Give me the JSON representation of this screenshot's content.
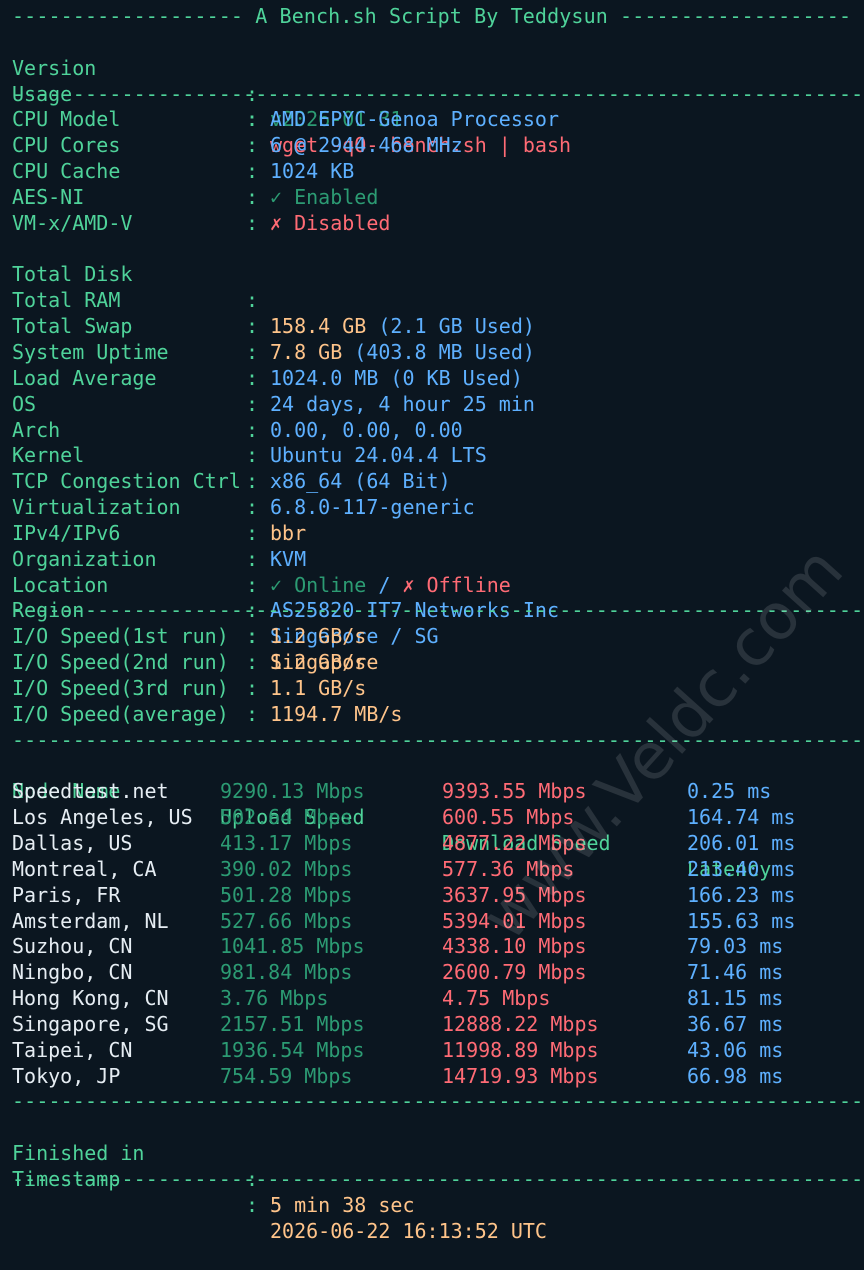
{
  "header": {
    "title_line": "------------------- A Bench.sh Script By Teddysun -------------------"
  },
  "meta": {
    "version_label": "Version",
    "version_value": "v2026-01-31",
    "usage_label": "Usage",
    "usage_value": "wget -qO- bench.sh | bash"
  },
  "separator": "----------------------------------------------------------------------",
  "system": {
    "rows": [
      {
        "label": "CPU Model",
        "value": "AMD EPYC-Genoa Processor",
        "color": "blue"
      },
      {
        "label": "CPU Cores",
        "value": "6 @ 2944.468 MHz",
        "color": "blue"
      },
      {
        "label": "CPU Cache",
        "value": "1024 KB",
        "color": "blue"
      },
      {
        "label": "AES-NI",
        "value": "✓ Enabled",
        "color": "green"
      },
      {
        "label": "VM-x/AMD-V",
        "value": "✗ Disabled",
        "color": "red"
      }
    ],
    "disk_label": "Total Disk",
    "disk_total": "158.4 GB",
    "disk_used": "(2.1 GB Used)",
    "ram_label": "Total RAM",
    "ram_total": "7.8 GB",
    "ram_used": "(403.8 MB Used)",
    "swap_label": "Total Swap",
    "swap_value": "1024.0 MB (0 KB Used)",
    "uptime_label": "System Uptime",
    "uptime_value": "24 days, 4 hour 25 min",
    "load_label": "Load Average",
    "load_value": "0.00, 0.00, 0.00",
    "os_label": "OS",
    "os_value": "Ubuntu 24.04.4 LTS",
    "arch_label": "Arch",
    "arch_value": "x86_64 (64 Bit)",
    "kernel_label": "Kernel",
    "kernel_value": "6.8.0-117-generic",
    "tcp_label": "TCP Congestion Ctrl",
    "tcp_value": "bbr",
    "virt_label": "Virtualization",
    "virt_value": "KVM",
    "ip_label": "IPv4/IPv6",
    "ipv4_value": "✓ Online",
    "ip_slash": "/",
    "ipv6_value": "✗ Offline",
    "org_label": "Organization",
    "org_value": "AS25820 IT7 Networks Inc",
    "location_label": "Location",
    "location_value": "Singapore / SG",
    "region_label": "Region",
    "region_value": "Singapore"
  },
  "io": {
    "rows": [
      {
        "label": "I/O Speed(1st run)",
        "value": "1.2 GB/s"
      },
      {
        "label": "I/O Speed(2nd run)",
        "value": "1.2 GB/s"
      },
      {
        "label": "I/O Speed(3rd run)",
        "value": "1.1 GB/s"
      },
      {
        "label": "I/O Speed(average)",
        "value": "1194.7 MB/s"
      }
    ]
  },
  "speedtest": {
    "headers": [
      "Node Name",
      "Upload Speed",
      "Download Speed",
      "Latency"
    ],
    "rows": [
      {
        "node": "Speedtest.net",
        "upload": "9290.13 Mbps",
        "download": "9393.55 Mbps",
        "latency": "0.25 ms"
      },
      {
        "node": "Los Angeles, US",
        "upload": "502.64 Mbps",
        "download": "600.55 Mbps",
        "latency": "164.74 ms"
      },
      {
        "node": "Dallas, US",
        "upload": "413.17 Mbps",
        "download": "4877.22 Mbps",
        "latency": "206.01 ms"
      },
      {
        "node": "Montreal, CA",
        "upload": "390.02 Mbps",
        "download": "577.36 Mbps",
        "latency": "213.40 ms"
      },
      {
        "node": "Paris, FR",
        "upload": "501.28 Mbps",
        "download": "3637.95 Mbps",
        "latency": "166.23 ms"
      },
      {
        "node": "Amsterdam, NL",
        "upload": "527.66 Mbps",
        "download": "5394.01 Mbps",
        "latency": "155.63 ms"
      },
      {
        "node": "Suzhou, CN",
        "upload": "1041.85 Mbps",
        "download": "4338.10 Mbps",
        "latency": "79.03 ms"
      },
      {
        "node": "Ningbo, CN",
        "upload": "981.84 Mbps",
        "download": "2600.79 Mbps",
        "latency": "71.46 ms"
      },
      {
        "node": "Hong Kong, CN",
        "upload": "3.76 Mbps",
        "download": "4.75 Mbps",
        "latency": "81.15 ms"
      },
      {
        "node": "Singapore, SG",
        "upload": "2157.51 Mbps",
        "download": "12888.22 Mbps",
        "latency": "36.67 ms"
      },
      {
        "node": "Taipei, CN",
        "upload": "1936.54 Mbps",
        "download": "11998.89 Mbps",
        "latency": "43.06 ms"
      },
      {
        "node": "Tokyo, JP",
        "upload": "754.59 Mbps",
        "download": "14719.93 Mbps",
        "latency": "66.98 ms"
      }
    ]
  },
  "footer": {
    "finished_label": "Finished in",
    "finished_value": "5 min 38 sec",
    "timestamp_label": "Timestamp",
    "timestamp_value": "2026-06-22 16:13:52 UTC"
  },
  "watermark": "www.Veldc.com",
  "colors": {
    "background": "#0b1620",
    "label_green": "#4fd39a",
    "value_blue": "#5eb0ff",
    "value_orange": "#ffc48a",
    "value_red": "#ff6b75",
    "upload_green": "#2c9b73"
  }
}
